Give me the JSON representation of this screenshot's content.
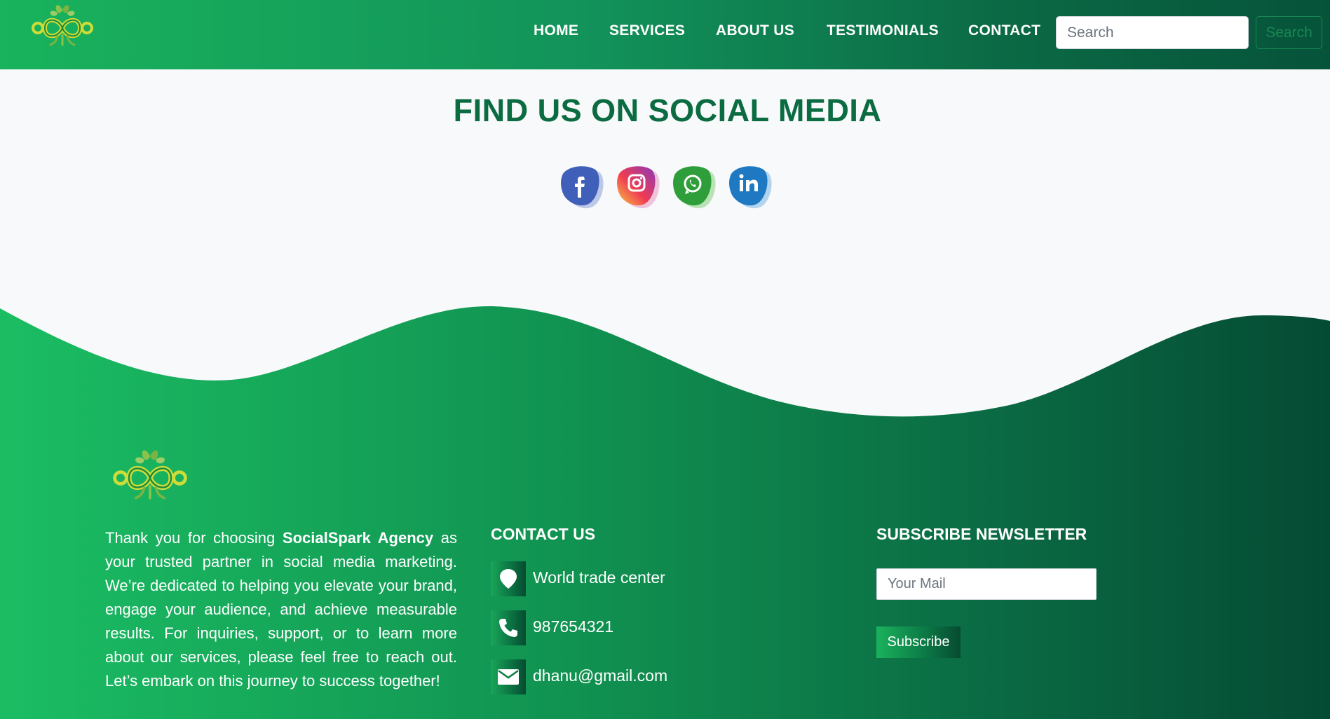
{
  "nav": {
    "links": [
      "HOME",
      "SERVICES",
      "ABOUT US",
      "TESTIMONIALS",
      "CONTACT"
    ],
    "search_placeholder": "Search",
    "search_button": "Search"
  },
  "social": {
    "title": "FIND US ON SOCIAL MEDIA",
    "icons": [
      "facebook-icon",
      "instagram-icon",
      "whatsapp-icon",
      "linkedin-icon"
    ]
  },
  "footer": {
    "about": {
      "prefix": "Thank you for choosing ",
      "brand": "SocialSpark Agency",
      "suffix": " as your trusted partner in social media marketing. We’re dedicated to helping you elevate your brand, engage your audience, and achieve measurable results. For inquiries, support, or to learn more about our services, please feel free to reach out. Let’s embark on this journey to success together!"
    },
    "contact": {
      "heading": "CONTACT US",
      "address": "World trade center",
      "phone": "987654321",
      "email": "dhanu@gmail.com"
    },
    "newsletter": {
      "heading": "SUBSCRIBE NEWSLETTER",
      "placeholder": "Your Mail",
      "button": "Subscribe"
    }
  },
  "colors": {
    "brand_green": "#198754",
    "heading_green": "#0b6b41",
    "footer_dark": "#054b34",
    "footer_light": "#1bbd63"
  }
}
